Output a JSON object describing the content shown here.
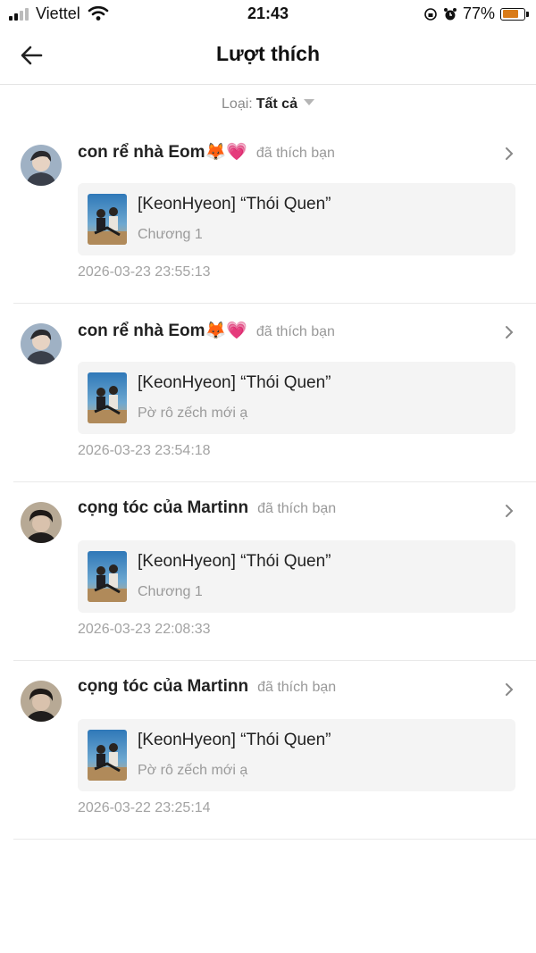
{
  "status": {
    "carrier": "Viettel",
    "time": "21:43",
    "battery": "77%",
    "battery_level": 0.77
  },
  "nav": {
    "title": "Lượt thích",
    "back_icon": "arrow-left-icon"
  },
  "filter": {
    "label": "Loại:",
    "value": "Tất cả"
  },
  "items": [
    {
      "user": "con rể nhà Eom🦊💗",
      "action": "đã thích bạn",
      "card_title": "[KeonHyeon] “Thói Quen”",
      "card_sub": "Chương 1",
      "time": "2026-03-23 23:55:13"
    },
    {
      "user": "con rể nhà Eom🦊💗",
      "action": "đã thích bạn",
      "card_title": "[KeonHyeon] “Thói Quen”",
      "card_sub": "Pờ rô zếch mới ạ",
      "time": "2026-03-23 23:54:18"
    },
    {
      "user": "cọng tóc của Martinn",
      "action": "đã thích bạn",
      "card_title": "[KeonHyeon] “Thói Quen”",
      "card_sub": "Chương 1",
      "time": "2026-03-23 22:08:33"
    },
    {
      "user": "cọng tóc của Martinn",
      "action": "đã thích bạn",
      "card_title": "[KeonHyeon] “Thói Quen”",
      "card_sub": "Pờ rô zếch mới ạ",
      "time": "2026-03-22 23:25:14"
    }
  ]
}
